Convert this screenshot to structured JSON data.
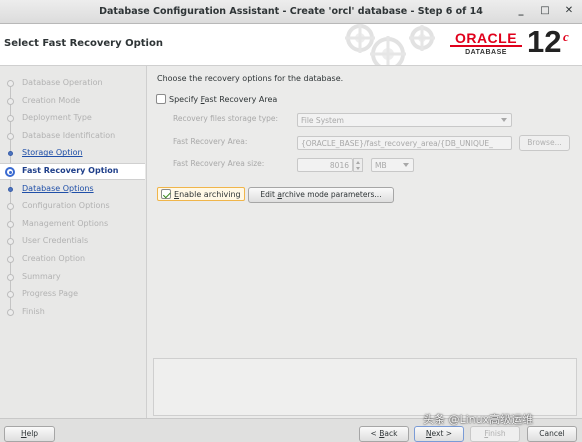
{
  "window": {
    "title": "Database Configuration Assistant - Create 'orcl' database - Step 6 of 14",
    "minimize": "_",
    "maximize": "□",
    "close": "✕"
  },
  "header": {
    "title": "Select Fast Recovery Option",
    "logo_oracle": "ORACLE",
    "logo_database": "DATABASE",
    "logo_version": "12",
    "logo_version_suffix": "c"
  },
  "steps": [
    {
      "label": "Database Operation",
      "state": "done"
    },
    {
      "label": "Creation Mode",
      "state": "done"
    },
    {
      "label": "Deployment Type",
      "state": "done"
    },
    {
      "label": "Database Identification",
      "state": "done"
    },
    {
      "label": "Storage Option",
      "state": "link"
    },
    {
      "label": "Fast Recovery Option",
      "state": "current"
    },
    {
      "label": "Database Options",
      "state": "link"
    },
    {
      "label": "Configuration Options",
      "state": "pending"
    },
    {
      "label": "Management Options",
      "state": "pending"
    },
    {
      "label": "User Credentials",
      "state": "pending"
    },
    {
      "label": "Creation Option",
      "state": "pending"
    },
    {
      "label": "Summary",
      "state": "pending"
    },
    {
      "label": "Progress Page",
      "state": "pending"
    },
    {
      "label": "Finish",
      "state": "pending"
    }
  ],
  "content": {
    "intro": "Choose the recovery options for the database.",
    "specify_fra": {
      "label": "Specify Fast Recovery Area",
      "checked": false
    },
    "storage_type": {
      "label": "Recovery files storage type:",
      "value": "File System"
    },
    "fra_location": {
      "label": "Fast Recovery Area:",
      "value": "{ORACLE_BASE}/fast_recovery_area/{DB_UNIQUE_",
      "browse": "Browse..."
    },
    "fra_size": {
      "label": "Fast Recovery Area size:",
      "value": "8016",
      "unit": "MB"
    },
    "enable_archiving": {
      "label": "Enable archiving",
      "checked": true
    },
    "edit_archive_button": "Edit archive mode parameters..."
  },
  "footer": {
    "help": "Help",
    "back": "< Back",
    "next": "Next >",
    "finish": "Finish",
    "cancel": "Cancel"
  },
  "watermark": "头条 @Linux高级运维",
  "colors": {
    "oracle_red": "#e0001b",
    "link_blue": "#1f4fa8",
    "highlight_orange": "#f0b54a"
  }
}
